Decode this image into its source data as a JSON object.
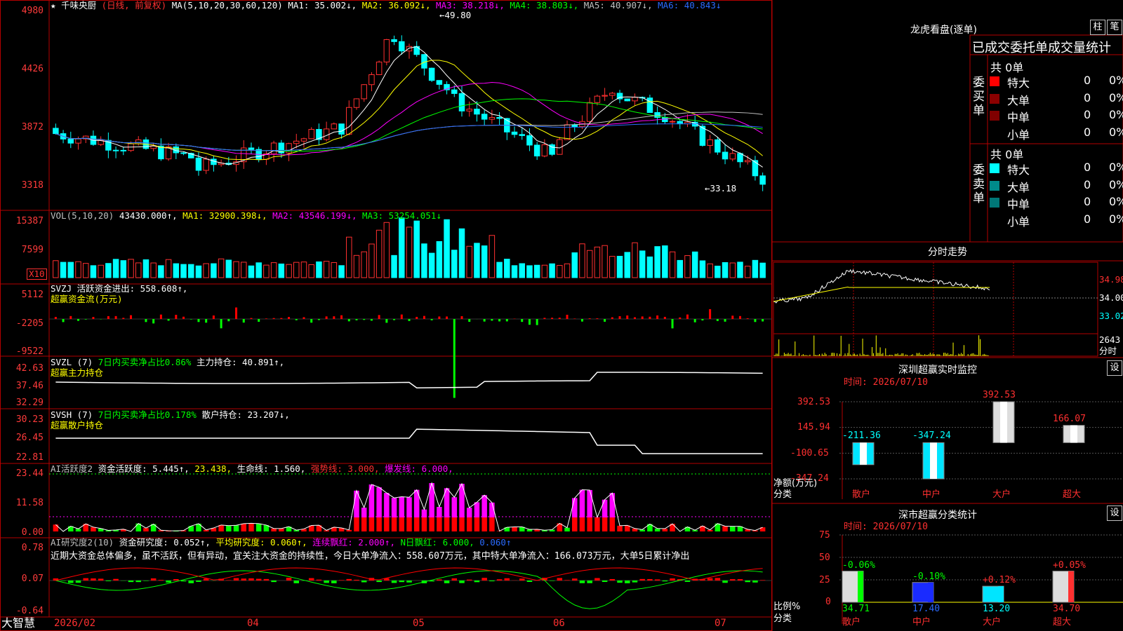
{
  "stock": {
    "star": "★",
    "name": "千味央厨",
    "mode": "(日线, 前复权)"
  },
  "ma_legend": {
    "prefix": "MA(5,10,20,30,60,120)",
    "items": [
      {
        "label": "MA1: 35.002↓,",
        "color": "#ffffff"
      },
      {
        "label": "MA2: 36.092↓,",
        "color": "#ffff00"
      },
      {
        "label": "MA3: 38.218↓,",
        "color": "#ff00ff"
      },
      {
        "label": "MA4: 38.803↓,",
        "color": "#00ff00"
      },
      {
        "label": "MA5: 40.907↓,",
        "color": "#c0c0c0"
      },
      {
        "label": "MA6: 40.843↓",
        "color": "#2a6bff"
      }
    ]
  },
  "price_axis": [
    "4980",
    "4426",
    "3872",
    "3318"
  ],
  "price_marks": {
    "high": "←49.80",
    "low": "←33.18"
  },
  "vol_legend": [
    {
      "label": "VOL(5,10,20)",
      "color": "#c0c0c0"
    },
    {
      "label": "43430.000↑,",
      "color": "#ffffff"
    },
    {
      "label": "MA1: 32900.398↓,",
      "color": "#ffff00"
    },
    {
      "label": "MA2: 43546.199↓,",
      "color": "#ff00ff"
    },
    {
      "label": "MA3: 53254.051↓",
      "color": "#00ff00"
    }
  ],
  "vol_axis": [
    "15387",
    "7599"
  ],
  "vol_unit": "X10",
  "svzj": {
    "line1": "SVZJ  活跃资金进出: 558.608↑,",
    "line2": "超赢资金流(万元)",
    "axis": [
      "5112",
      "-2205",
      "-9522"
    ]
  },
  "svzl": {
    "line1a": "SVZL (7)",
    "line1b": "7日内买卖净占比0.86%",
    "line1c": "主力持仓: 40.891↑,",
    "line2": "超赢主力持仓",
    "axis": [
      "42.63",
      "37.46",
      "32.29"
    ]
  },
  "svsh": {
    "line1a": "SVSH (7)",
    "line1b": "7日内买卖净占比0.178%",
    "line1c": "散户持仓: 23.207↓,",
    "line2": "超赢散户持仓",
    "axis": [
      "30.23",
      "26.45",
      "22.81"
    ]
  },
  "ai1": {
    "items": [
      {
        "label": "AI活跃度2",
        "color": "#c0c0c0"
      },
      {
        "label": "资金活跃度: 5.445↑,",
        "color": "#ffffff"
      },
      {
        "label": "23.438,",
        "color": "#ffff00"
      },
      {
        "label": "生命线: 1.560,",
        "color": "#ffffff"
      },
      {
        "label": "强势线: 3.000,",
        "color": "#ff3030"
      },
      {
        "label": "爆发线: 6.000,",
        "color": "#ff00ff"
      }
    ],
    "axis": [
      "23.44",
      "11.58",
      "0.00"
    ]
  },
  "ai2": {
    "items": [
      {
        "label": "AI研究度2(10)",
        "color": "#c0c0c0"
      },
      {
        "label": "资金研究度: 0.052↑,",
        "color": "#ffffff"
      },
      {
        "label": "平均研究度: 0.060↑,",
        "color": "#ffff00"
      },
      {
        "label": "连续飘红: 2.000↑,",
        "color": "#ff00ff"
      },
      {
        "label": "N日飘红: 6.000,",
        "color": "#00ff00"
      },
      {
        "label": "0.060↑",
        "color": "#2a6bff"
      }
    ],
    "comment": "近期大资金总体偏多，虽不活跃，但有异动，宜关注大资金的持续性，今日大单净流入：558.607万元，其中特大单净流入：166.073万元，大单5日累计净出",
    "axis": [
      "0.78",
      "0.07",
      "-0.64"
    ]
  },
  "footer": {
    "brand": "大智慧",
    "dates": [
      "2026/02",
      "04",
      "05",
      "06",
      "07"
    ]
  },
  "dragon": {
    "title": "龙虎看盘(逐单)",
    "btn1": "柱",
    "btn2": "笔",
    "header": "已成交委托单成交量统计",
    "buy_side": "委买单",
    "sell_side": "委卖单",
    "buy_total": "共 0单",
    "sell_total": "共 0单",
    "buy_rows": [
      {
        "name": "特大",
        "count": "0",
        "pct": "0%",
        "color": "#ff0000"
      },
      {
        "name": "大单",
        "count": "0",
        "pct": "0%",
        "color": "#8b0000"
      },
      {
        "name": "中单",
        "count": "0",
        "pct": "0%",
        "color": "#800000"
      },
      {
        "name": "小单",
        "count": "0",
        "pct": "0%",
        "color": "#000000"
      }
    ],
    "sell_rows": [
      {
        "name": "特大",
        "count": "0",
        "pct": "0%",
        "color": "#00ffff"
      },
      {
        "name": "大单",
        "count": "0",
        "pct": "0%",
        "color": "#008b8b"
      },
      {
        "name": "中单",
        "count": "0",
        "pct": "0%",
        "color": "#007777"
      },
      {
        "name": "小单",
        "count": "0",
        "pct": "0%",
        "color": "#000000"
      }
    ]
  },
  "intraday": {
    "title": "分时走势",
    "axis": [
      "34.98",
      "34.00",
      "33.02"
    ],
    "vol_label": "2643",
    "vol_unit": "分时"
  },
  "monitor": {
    "title": "深圳超赢实时监控",
    "btn": "设",
    "time": "时间: 2026/07/10",
    "axis": [
      "392.53",
      "145.94",
      "-100.65",
      "-347.24"
    ],
    "ylabel": "净额(万元)",
    "xlabel": "分类",
    "chart_data": {
      "type": "bar",
      "categories": [
        "散户",
        "中户",
        "大户",
        "超大"
      ],
      "values": [
        -211.36,
        -347.24,
        392.53,
        166.07
      ],
      "value_labels": [
        "-211.36",
        "-347.24",
        "392.53",
        "166.07"
      ],
      "ylim": [
        -347.24,
        392.53
      ]
    }
  },
  "classify": {
    "title": "深市超赢分类统计",
    "btn": "设",
    "time": "时间: 2026/07/10",
    "axis": [
      "75",
      "50",
      "25",
      "0"
    ],
    "ylabel": "比例%",
    "xlabel": "分类",
    "chart_data": {
      "type": "bar",
      "categories": [
        "散户",
        "中户",
        "大户",
        "超大"
      ],
      "values": [
        34.71,
        17.4,
        13.2,
        34.7
      ],
      "changes": [
        "-0.06%",
        "-0.10%",
        "+0.12%",
        "+0.05%"
      ],
      "value_labels": [
        "34.71",
        "17.40",
        "13.20",
        "34.70"
      ],
      "ylim": [
        0,
        75
      ]
    }
  }
}
